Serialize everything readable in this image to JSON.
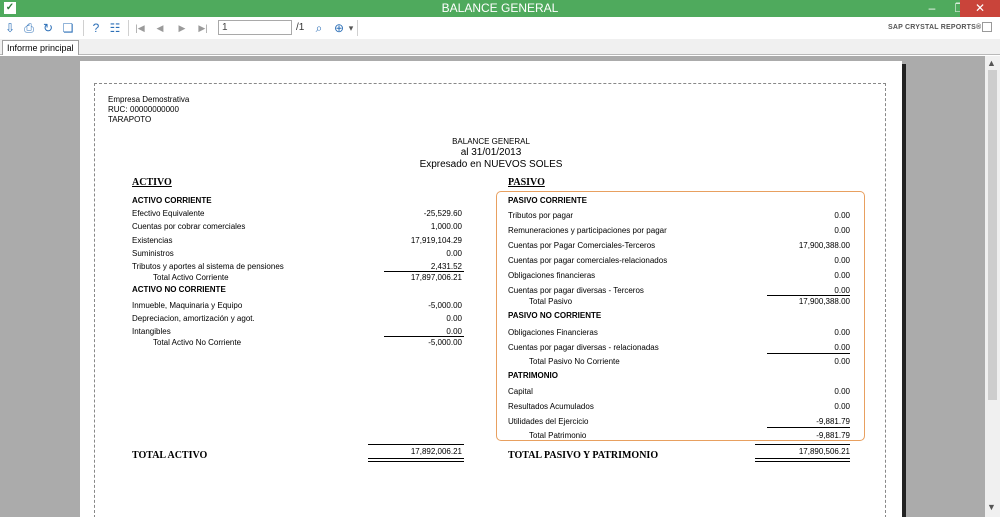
{
  "window": {
    "title": "BALANCE GENERAL",
    "app_icon": "crystal-icon"
  },
  "toolbar": {
    "page_current": "1",
    "page_total": "/1",
    "brand": "SAP CRYSTAL REPORTS®"
  },
  "tabs": [
    {
      "label": "Informe principal"
    }
  ],
  "report": {
    "company": {
      "name": "Empresa Demostrativa",
      "ruc_label": "RUC:",
      "ruc_value": "00000000000",
      "city": "TARAPOTO"
    },
    "header": {
      "title": "BALANCE GENERAL",
      "date": "al 31/01/2013",
      "currency": "Expresado en NUEVOS SOLES"
    },
    "activo": {
      "heading": "ACTIVO",
      "corriente_heading": "ACTIVO CORRIENTE",
      "corriente": [
        {
          "label": "Efectivo Equivalente",
          "value": "-25,529.60"
        },
        {
          "label": "Cuentas por cobrar comerciales",
          "value": "1,000.00"
        },
        {
          "label": "Existencias",
          "value": "17,919,104.29"
        },
        {
          "label": "Suministros",
          "value": "0.00"
        },
        {
          "label": "Tributos y aportes al sistema de pensiones",
          "value": "2,431.52"
        }
      ],
      "total_corriente_label": "Total Activo Corriente",
      "total_corriente_value": "17,897,006.21",
      "no_corriente_heading": "ACTIVO NO CORRIENTE",
      "no_corriente": [
        {
          "label": "Inmueble, Maquinaria y Equipo",
          "value": "-5,000.00"
        },
        {
          "label": "Depreciacion, amortización y agot.",
          "value": "0.00"
        },
        {
          "label": "Intangibles",
          "value": "0.00"
        }
      ],
      "total_no_corriente_label": "Total Activo No Corriente",
      "total_no_corriente_value": "-5,000.00",
      "total_label": "TOTAL ACTIVO",
      "total_value": "17,892,006.21"
    },
    "pasivo": {
      "heading": "PASIVO",
      "corriente_heading": "PASIVO CORRIENTE",
      "corriente": [
        {
          "label": "Tributos por pagar",
          "value": "0.00"
        },
        {
          "label": "Remuneraciones y participaciones por pagar",
          "value": "0.00"
        },
        {
          "label": "Cuentas por Pagar Comerciales-Terceros",
          "value": "17,900,388.00"
        },
        {
          "label": "Cuentas por pagar comerciales-relacionados",
          "value": "0.00"
        },
        {
          "label": "Obligaciones financieras",
          "value": "0.00"
        },
        {
          "label": "Cuentas por pagar diversas - Terceros",
          "value": "0.00"
        }
      ],
      "total_pasivo_label": "Total Pasivo",
      "total_pasivo_value": "17,900,388.00",
      "no_corriente_heading": "PASIVO NO CORRIENTE",
      "no_corriente": [
        {
          "label": "Obligaciones Financieras",
          "value": "0.00"
        },
        {
          "label": "Cuentas por pagar diversas - relacionadas",
          "value": "0.00"
        }
      ],
      "total_no_corriente_label": "Total Pasivo No Corriente",
      "total_no_corriente_value": "0.00",
      "patrimonio_heading": "PATRIMONIO",
      "patrimonio": [
        {
          "label": "Capital",
          "value": "0.00"
        },
        {
          "label": "Resultados Acumulados",
          "value": "0.00"
        },
        {
          "label": "Utilidades del Ejercicio",
          "value": "-9,881.79"
        }
      ],
      "total_patrimonio_label": "Total Patrimonio",
      "total_patrimonio_value": "-9,881.79",
      "total_label": "TOTAL PASIVO Y PATRIMONIO",
      "total_value": "17,890,506.21"
    }
  }
}
